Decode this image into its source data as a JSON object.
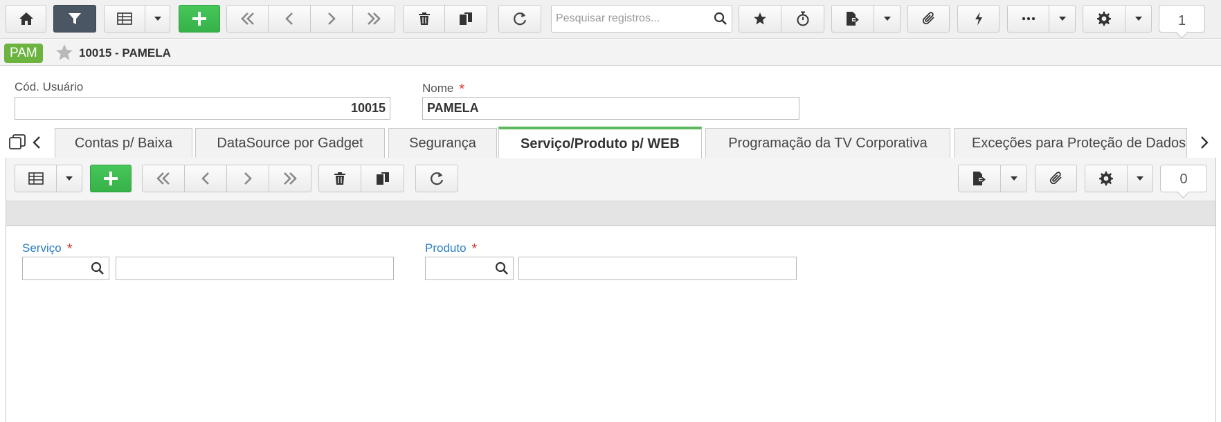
{
  "toolbar": {
    "search_placeholder": "Pesquisar registros...",
    "record_counter": "1"
  },
  "record": {
    "badge": "PAM",
    "title": "10015 - PAMELA"
  },
  "fields": {
    "cod_usuario_label": "Cód. Usuário",
    "cod_usuario_value": "10015",
    "nome_label": "Nome",
    "nome_value": "PAMELA",
    "required_mark": "*"
  },
  "tabs": [
    {
      "label": "Contas p/ Baixa"
    },
    {
      "label": "DataSource por Gadget"
    },
    {
      "label": "Segurança"
    },
    {
      "label": "Serviço/Produto p/ WEB"
    },
    {
      "label": "Programação da TV Corporativa"
    },
    {
      "label": "Exceções para Proteção de Dados"
    }
  ],
  "subform": {
    "record_counter": "0",
    "servico_label": "Serviço",
    "produto_label": "Produto"
  },
  "colors": {
    "accent_green": "#36b248",
    "badge_green": "#6cb33f",
    "active_tab_border": "#5cb85c",
    "required_red": "#d9342b",
    "label_blue": "#2a7dc5",
    "dark_button": "#4a5663"
  }
}
